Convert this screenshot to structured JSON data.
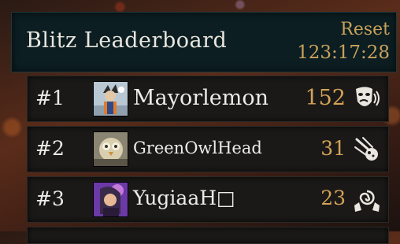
{
  "header": {
    "title": "Blitz Leaderboard",
    "reset_label": "Reset",
    "reset_timer": "123:17:28"
  },
  "rows": [
    {
      "rank": "#1",
      "name": "Mayorlemon",
      "score": "152",
      "badge_icon": "theatre-mask-icon"
    },
    {
      "rank": "#2",
      "name": "GreenOwlHead",
      "score": "31",
      "badge_icon": "comet-icon"
    },
    {
      "rank": "#3",
      "name": "YugiaaH□",
      "score": "23",
      "badge_icon": "spiral-hands-icon"
    }
  ],
  "colors": {
    "header_bg": "#0c1e22",
    "title": "#e8e6de",
    "accent_gold": "#c9a25a",
    "row_bg": "#1a1918"
  }
}
